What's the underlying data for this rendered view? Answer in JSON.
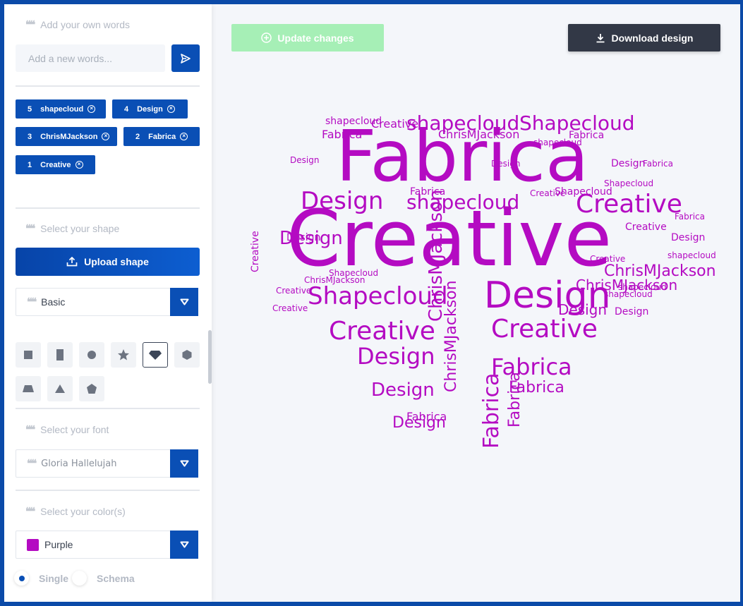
{
  "sidebar": {
    "words_section": {
      "title": "Add your own words",
      "placeholder": "Add a new words..."
    },
    "words": [
      {
        "count": "5",
        "label": "shapecloud"
      },
      {
        "count": "4",
        "label": "Design"
      },
      {
        "count": "3",
        "label": "ChrisMJackson"
      },
      {
        "count": "2",
        "label": "Fabrica"
      },
      {
        "count": "1",
        "label": "Creative"
      }
    ],
    "shape_section": {
      "title": "Select your shape",
      "upload_label": "Upload shape",
      "category": "Basic"
    },
    "shapes": [
      "square-icon",
      "rectangle-icon",
      "circle-icon",
      "star-icon",
      "diamond-icon",
      "hexagon-icon",
      "trapezoid-icon",
      "triangle-icon",
      "pentagon-icon"
    ],
    "font_section": {
      "title": "Select your font",
      "selected": "Gloria Hallelujah"
    },
    "color_section": {
      "title": "Select your color(s)",
      "selected": "Purple",
      "swatch": "#b40bc2"
    },
    "mode": {
      "single": "Single",
      "schema": "Schema"
    }
  },
  "toolbar": {
    "update_label": "Update changes",
    "download_label": "Download design"
  },
  "cloud": {
    "color": "#b40bc2",
    "words": [
      "Fabrica",
      "Creative",
      "shapecloud",
      "Design",
      "ChrisMJackson",
      "Shapecloud"
    ]
  }
}
